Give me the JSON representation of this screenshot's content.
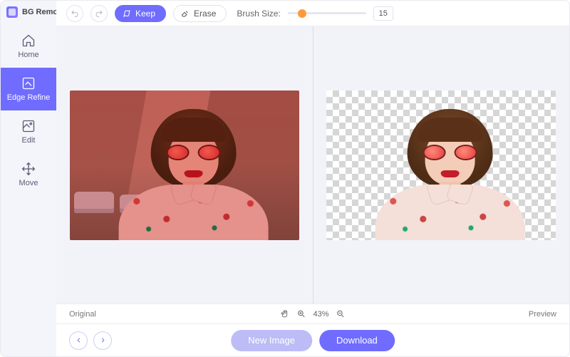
{
  "app": {
    "title": "BG Remover"
  },
  "sidebar": {
    "items": [
      {
        "label": "Home"
      },
      {
        "label": "Edge Refine"
      },
      {
        "label": "Edit"
      },
      {
        "label": "Move"
      }
    ],
    "active_index": 1
  },
  "toolbar": {
    "keep_label": "Keep",
    "erase_label": "Erase",
    "brush_label": "Brush Size:",
    "brush_value": "15",
    "brush_min": 1,
    "brush_max": 100
  },
  "panes": {
    "left_caption": "Original",
    "right_caption": "Preview"
  },
  "status": {
    "zoom_percent": "43%"
  },
  "bottom": {
    "new_image_label": "New Image",
    "download_label": "Download"
  },
  "colors": {
    "accent": "#6f6cff",
    "slider_thumb": "#ff9a3c"
  }
}
